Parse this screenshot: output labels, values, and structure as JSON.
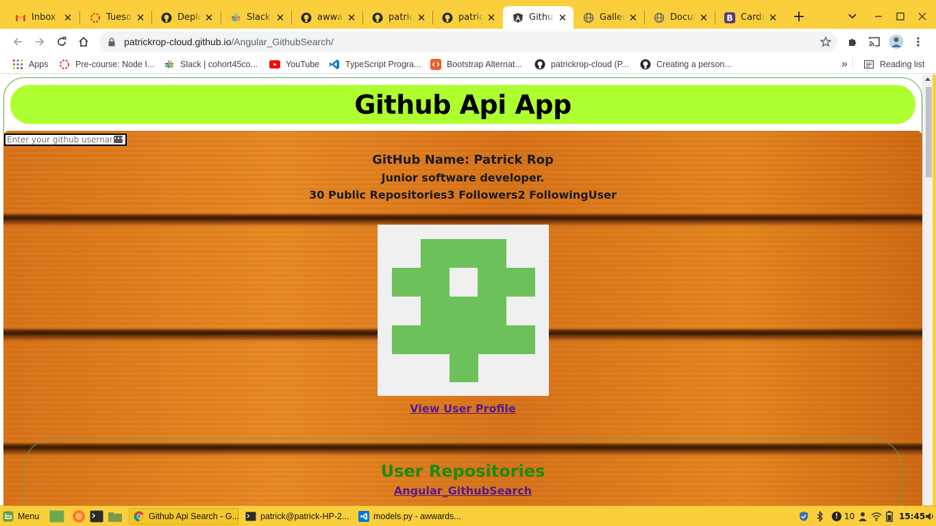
{
  "browser": {
    "tabs": [
      {
        "title": "Inbox - ",
        "icon": "gmail-icon",
        "active": false
      },
      {
        "title": "Tuesda",
        "icon": "loading-ring-icon",
        "active": false
      },
      {
        "title": "Deploy",
        "icon": "github-icon",
        "active": false
      },
      {
        "title": "Slack | ",
        "icon": "slack-icon",
        "active": false
      },
      {
        "title": "awwar",
        "icon": "github-icon",
        "active": false
      },
      {
        "title": "patrick",
        "icon": "github-icon",
        "active": false
      },
      {
        "title": "patrick",
        "icon": "github-icon",
        "active": false
      },
      {
        "title": "Github",
        "icon": "angular-icon",
        "active": true
      },
      {
        "title": "Gallery",
        "icon": "globe-icon",
        "active": false
      },
      {
        "title": "Docum",
        "icon": "globe-icon",
        "active": false
      },
      {
        "title": "Cards",
        "icon": "bootstrap-icon",
        "active": false
      }
    ],
    "url_host": "patrickrop-cloud.github.io",
    "url_path": "/Angular_GithubSearch/",
    "bookmarks": [
      {
        "label": "Apps",
        "icon": "apps-grid-icon"
      },
      {
        "label": "Pre-course: Node I...",
        "icon": "loading-ring-icon"
      },
      {
        "label": "Slack | cohort45co...",
        "icon": "slack-icon"
      },
      {
        "label": "YouTube",
        "icon": "youtube-icon"
      },
      {
        "label": "TypeScript Progra...",
        "icon": "vscode-icon"
      },
      {
        "label": "Bootstrap Alternat...",
        "icon": "code-orange-icon"
      },
      {
        "label": "patrickrop-cloud (P...",
        "icon": "github-icon"
      },
      {
        "label": "Creating a person...",
        "icon": "github-icon"
      }
    ],
    "overflow_label": "»",
    "reading_list_label": "Reading list"
  },
  "page": {
    "title": "Github Api App",
    "search_placeholder": "Enter your github username",
    "github_name": "GitHub Name: Patrick Rop",
    "bio": "Junior software developer.",
    "stats": "30 Public Repositories3 Followers2 FollowingUser",
    "profile_link": "View User Profile",
    "repos_title": "User Repositories",
    "repo_name": "Angular_GithubSearch",
    "colors": {
      "header_bg": "#adff2f",
      "repos_title": "#1e8a10",
      "link": "#551a8b",
      "avatar_fg": "#6cc15a",
      "avatar_bg": "#f0f0f0"
    }
  },
  "taskbar": {
    "menu_label": "Menu",
    "windows": [
      {
        "label": "Github Api Search - G...",
        "icon": "chrome-icon"
      },
      {
        "label": "patrick@patrick-HP-2...",
        "icon": "terminal-icon"
      },
      {
        "label": "models.py - awwards...",
        "icon": "vscode-icon"
      }
    ],
    "notification_count": "10",
    "clock": "15:45"
  }
}
